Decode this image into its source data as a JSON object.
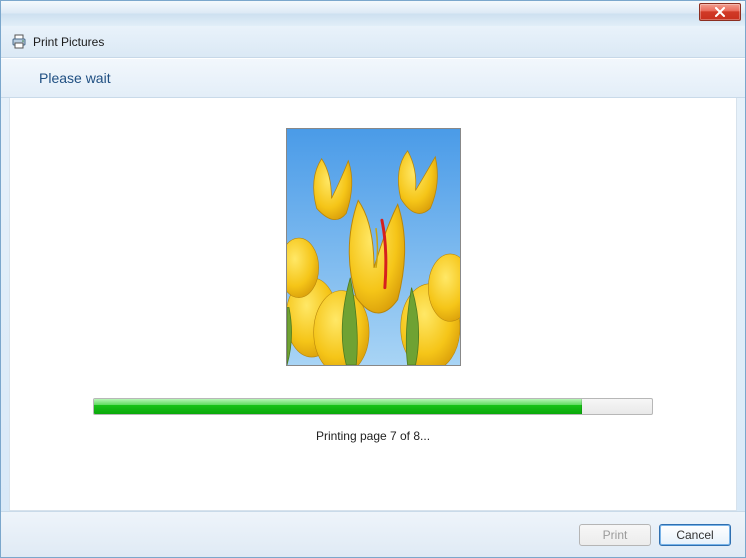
{
  "window": {
    "title": "Print Pictures"
  },
  "header": {
    "text": "Please wait"
  },
  "status": {
    "text": "Printing page 7 of 8...",
    "current_page": 7,
    "total_pages": 8,
    "progress_percent": 87.5
  },
  "footer": {
    "print_label": "Print",
    "cancel_label": "Cancel"
  },
  "icons": {
    "app": "printer-icon",
    "close": "close-icon"
  }
}
